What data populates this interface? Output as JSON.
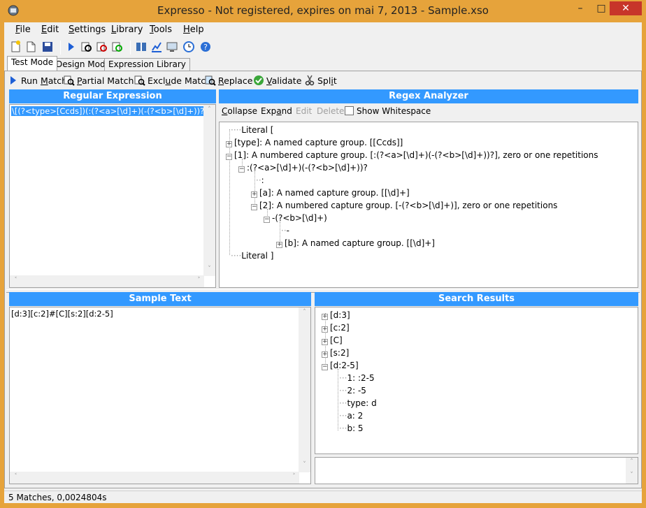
{
  "window": {
    "title": "Expresso - Not registered, expires on mai 7, 2013 - Sample.xso",
    "minimize": "–",
    "maximize": "□",
    "close": "✕"
  },
  "menu": [
    {
      "pre": "",
      "key": "F",
      "post": "ile"
    },
    {
      "pre": "",
      "key": "E",
      "post": "dit"
    },
    {
      "pre": "",
      "key": "S",
      "post": "ettings"
    },
    {
      "pre": "",
      "key": "L",
      "post": "ibrary"
    },
    {
      "pre": "",
      "key": "T",
      "post": "ools"
    },
    {
      "pre": "",
      "key": "H",
      "post": "elp"
    }
  ],
  "tabs": [
    "Test Mode",
    "Design Mode",
    "Expression Library"
  ],
  "actions": {
    "run_match": {
      "pre": "Run ",
      "key": "M",
      "post": "atch"
    },
    "partial_match": {
      "pre": "",
      "key": "P",
      "post": "artial Match"
    },
    "exclude_match": {
      "pre": "Excl",
      "key": "u",
      "post": "de Match"
    },
    "replace": {
      "pre": "",
      "key": "R",
      "post": "eplace"
    },
    "validate": {
      "pre": "",
      "key": "V",
      "post": "alidate"
    },
    "split": {
      "pre": "Spl",
      "key": "i",
      "post": "t"
    }
  },
  "regex_panel": {
    "title": "Regular Expression",
    "value": "\\[(?<type>[Ccds])(:(?<a>[\\d]+)(-(?<b>[\\d]+))?)?\\]"
  },
  "analyzer": {
    "title": "Regex Analyzer",
    "collapse": {
      "pre": "",
      "key": "C",
      "post": "ollapse"
    },
    "expand": {
      "pre": "Exp",
      "key": "a",
      "post": "nd"
    },
    "edit": "Edit",
    "delete": "Delete",
    "show_whitespace": "Show Whitespace",
    "tree": [
      "Literal [",
      "[type]: A named capture group. [[Ccds]]",
      "[1]: A numbered capture group. [:(?<a>[\\d]+)(-(?<b>[\\d]+))?], zero or one repetitions",
      ":(?<a>[\\d]+)(-(?<b>[\\d]+))?",
      ":",
      "[a]: A named capture group. [[\\d]+]",
      "[2]: A numbered capture group. [-(?<b>[\\d]+)], zero or one repetitions",
      "-(?<b>[\\d]+)",
      "-",
      "[b]: A named capture group. [[\\d]+]",
      "Literal ]"
    ]
  },
  "sample": {
    "title": "Sample Text",
    "value": "[d:3][c:2]#[C][s:2][d:2-5]"
  },
  "results": {
    "title": "Search Results",
    "items": [
      "[d:3]",
      "[c:2]",
      "[C]",
      "[s:2]",
      "[d:2-5]"
    ],
    "children": [
      "1: :2-5",
      "2: -5",
      "type: d",
      "a: 2",
      "b: 5"
    ]
  },
  "status": "5 Matches, 0,0024804s",
  "colors": {
    "accent": "#3399ff",
    "frame": "#e6a33b",
    "close": "#c7352a"
  }
}
